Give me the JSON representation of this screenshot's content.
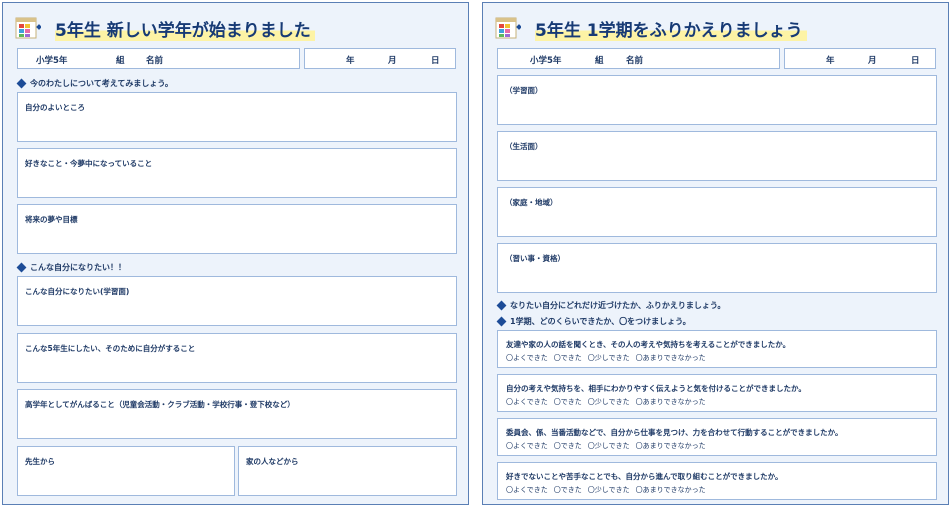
{
  "left": {
    "title": "5年生  新しい学年が始まりました",
    "name_row": {
      "school": "小学5年",
      "class": "組",
      "name": "名前"
    },
    "date_row": {
      "year": "年",
      "month": "月",
      "day": "日"
    },
    "section1": "今のわたしについて考えてみましょう。",
    "boxes1": [
      "自分のよいところ",
      "好きなこと・今夢中になっていること",
      "将来の夢や目標"
    ],
    "section2": "こんな自分になりたい！！",
    "boxes2": [
      "こんな自分になりたい(学習面)",
      "こんな5年生にしたい、そのために自分がすること",
      "高学年としてがんばること（児童会活動・クラブ活動・学校行事・登下校など）"
    ],
    "bottom_left": "先生から",
    "bottom_right": "家の人などから"
  },
  "right": {
    "title": "5年生  1学期をふりかえりましょう",
    "name_row": {
      "school": "小学5年",
      "class": "組",
      "name": "名前"
    },
    "date_row": {
      "year": "年",
      "month": "月",
      "day": "日"
    },
    "boxes": [
      "（学習面）",
      "（生活面）",
      "（家庭・地域）",
      "（習い事・資格）"
    ],
    "section1": "なりたい自分にどれだけ近づけたか、ふりかえりましょう。",
    "section2": "1学期、どのくらいできたか、〇をつけましょう。",
    "questions": [
      "友達や家の人の話を聞くとき、その人の考えや気持ちを考えることができましたか。",
      "自分の考えや気持ちを、相手にわかりやすく伝えようと気を付けることができましたか。",
      "委員会、係、当番活動などで、自分から仕事を見つけ、力を合わせて行動することができましたか。",
      "好きでないことや苦手なことでも、自分から進んで取り組むことができましたか。"
    ],
    "options": [
      "〇よくできた",
      "〇できた",
      "〇少しできた",
      "〇あまりできなかった"
    ]
  },
  "icon": "calendar-icon"
}
